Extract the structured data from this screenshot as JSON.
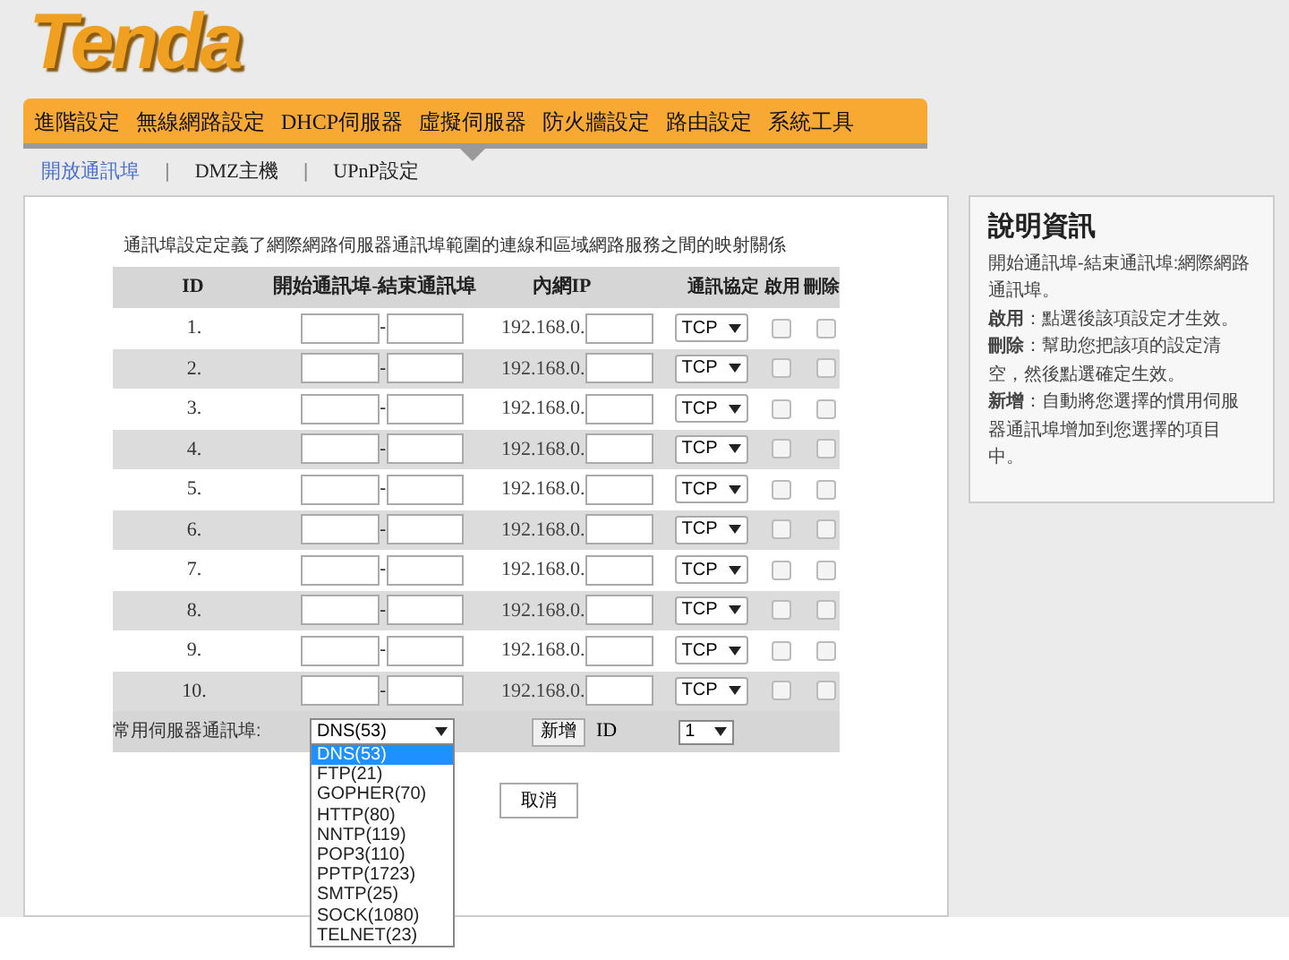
{
  "logo": "Tenda",
  "nav": [
    {
      "label": "進階設定",
      "selected": false
    },
    {
      "label": "無線網路設定",
      "selected": false
    },
    {
      "label": "DHCP伺服器",
      "selected": false
    },
    {
      "label": "虛擬伺服器",
      "selected": true
    },
    {
      "label": "防火牆設定",
      "selected": false
    },
    {
      "label": "路由設定",
      "selected": false
    },
    {
      "label": "系統工具",
      "selected": false
    }
  ],
  "subtab_separator": "|",
  "subtabs": [
    {
      "label": "開放通訊埠",
      "selected": true
    },
    {
      "label": "DMZ主機",
      "selected": false
    },
    {
      "label": "UPnP設定",
      "selected": false
    }
  ],
  "description": "通訊埠設定定義了網際網路伺服器通訊埠範圍的連線和區域網路服務之間的映射關係",
  "table": {
    "columns": [
      "ID",
      "開始通訊埠-結束通訊埠",
      "內網IP",
      "通訊協定",
      "啟用",
      "刪除"
    ],
    "separator": "-",
    "rows": [
      {
        "id": "1.",
        "ip_prefix": "192.168.0.",
        "protocol": "TCP",
        "enabled": false,
        "delete": false
      },
      {
        "id": "2.",
        "ip_prefix": "192.168.0.",
        "protocol": "TCP",
        "enabled": false,
        "delete": false
      },
      {
        "id": "3.",
        "ip_prefix": "192.168.0.",
        "protocol": "TCP",
        "enabled": false,
        "delete": false
      },
      {
        "id": "4.",
        "ip_prefix": "192.168.0.",
        "protocol": "TCP",
        "enabled": false,
        "delete": false
      },
      {
        "id": "5.",
        "ip_prefix": "192.168.0.",
        "protocol": "TCP",
        "enabled": false,
        "delete": false
      },
      {
        "id": "6.",
        "ip_prefix": "192.168.0.",
        "protocol": "TCP",
        "enabled": false,
        "delete": false
      },
      {
        "id": "7.",
        "ip_prefix": "192.168.0.",
        "protocol": "TCP",
        "enabled": false,
        "delete": false
      },
      {
        "id": "8.",
        "ip_prefix": "192.168.0.",
        "protocol": "TCP",
        "enabled": false,
        "delete": false
      },
      {
        "id": "9.",
        "ip_prefix": "192.168.0.",
        "protocol": "TCP",
        "enabled": false,
        "delete": false
      },
      {
        "id": "10.",
        "ip_prefix": "192.168.0.",
        "protocol": "TCP",
        "enabled": false,
        "delete": false
      }
    ]
  },
  "common_ports": {
    "label": "常用伺服器通訊埠:",
    "value": "DNS(53)",
    "add_button": "新增",
    "id_label": "ID",
    "id_value": "1",
    "options": [
      {
        "label": "DNS(53)",
        "selected": true
      },
      {
        "label": "FTP(21)",
        "selected": false
      },
      {
        "label": "GOPHER(70)",
        "selected": false
      },
      {
        "label": "HTTP(80)",
        "selected": false
      },
      {
        "label": "NNTP(119)",
        "selected": false
      },
      {
        "label": "POP3(110)",
        "selected": false
      },
      {
        "label": "PPTP(1723)",
        "selected": false
      },
      {
        "label": "SMTP(25)",
        "selected": false
      },
      {
        "label": "SOCK(1080)",
        "selected": false
      },
      {
        "label": "TELNET(23)",
        "selected": false
      }
    ]
  },
  "cancel_button": "取消",
  "help": {
    "title": "說明資訊",
    "paragraphs": [
      "開始通訊埠-結束通訊埠:網際網路通訊埠。",
      "**啟用**：點選後該項設定才生效。",
      "**刪除**：幫助您把該項的設定清空，然後點選確定生效。",
      "**新增**：自動將您選擇的慣用伺服器通訊埠增加到您選擇的項目中。"
    ]
  }
}
